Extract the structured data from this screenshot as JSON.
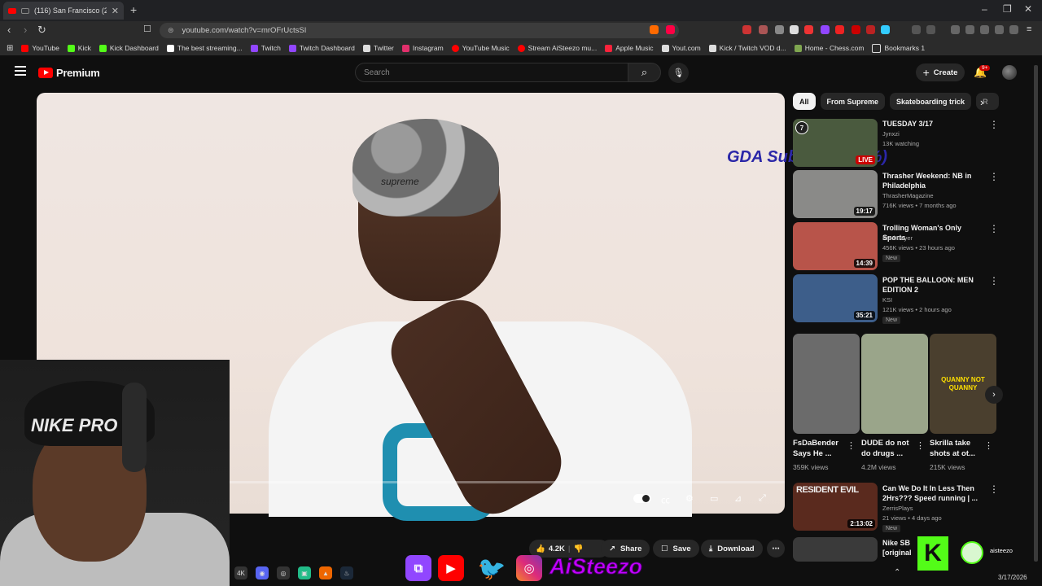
{
  "browser": {
    "tab_title": "(116) San Francisco (2026) - Y",
    "new_tab": "+",
    "url": "youtube.com/watch?v=mrOFrUctsSI",
    "window_controls": [
      "–",
      "❐",
      "✕"
    ]
  },
  "bookmarks": [
    {
      "label": "YouTube",
      "color": "#ff0000"
    },
    {
      "label": "Kick",
      "color": "#53fc18"
    },
    {
      "label": "Kick Dashboard",
      "color": "#53fc18"
    },
    {
      "label": "The best streaming...",
      "color": "#ffffff"
    },
    {
      "label": "Twitch",
      "color": "#9146ff"
    },
    {
      "label": "Twitch Dashboard",
      "color": "#9146ff"
    },
    {
      "label": "Twitter",
      "color": "#dddddd"
    },
    {
      "label": "Instagram",
      "color": "#e1306c"
    },
    {
      "label": "YouTube Music",
      "color": "#ff0000"
    },
    {
      "label": "Stream AiSteezo mu...",
      "color": "#ff0000"
    },
    {
      "label": "Apple Music",
      "color": "#fa233b"
    },
    {
      "label": "Yout.com",
      "color": "#dddddd"
    },
    {
      "label": "Kick / Twitch VOD d...",
      "color": "#dddddd"
    },
    {
      "label": "Home - Chess.com",
      "color": "#7fa650"
    },
    {
      "label": "Bookmarks 1",
      "color": "#dddddd"
    }
  ],
  "youtube": {
    "logo_text": "Premium",
    "search_placeholder": "Search",
    "create_label": "Create",
    "notif_badge": "9+"
  },
  "video": {
    "bandana_text": "supreme",
    "overlay_text": "GDA Subs: 5/67 (7%)",
    "actions": {
      "likes": "4.2K",
      "share": "Share",
      "save": "Save",
      "download": "Download"
    }
  },
  "webcam": {
    "hat_text": "NIKE PRO"
  },
  "stream_branding": {
    "name": "AiSteezo",
    "kick_user": "aisteezo"
  },
  "chips": [
    "All",
    "From Supreme",
    "Skateboarding trick",
    "R"
  ],
  "recommended": [
    {
      "title": "TUESDAY 3/17",
      "channel": "Jynxzi",
      "meta": "13K watching",
      "duration": "LIVE",
      "new": "",
      "thumb": "#4a5a3e"
    },
    {
      "title": "Thrasher Weekend: NB in Philadelphia",
      "channel": "ThrasherMagazine",
      "meta": "716K views • 7 months ago",
      "duration": "19:17",
      "new": "",
      "thumb": "#8a8a88"
    },
    {
      "title": "Trolling Woman's Only Sports",
      "channel": "Fred Beyer",
      "meta": "456K views • 23 hours ago",
      "duration": "14:39",
      "new": "New",
      "thumb": "#b8544a"
    },
    {
      "title": "POP THE BALLOON: MEN EDITION 2",
      "channel": "KSI",
      "meta": "121K views • 2 hours ago",
      "duration": "35:21",
      "new": "New",
      "thumb": "#3d5e8a"
    }
  ],
  "shorts": [
    {
      "title": "FsDaBender Says He ...",
      "views": "359K views",
      "thumb": "#6b6b6b"
    },
    {
      "title": "DUDE do not do drugs ...",
      "views": "4.2M views",
      "thumb": "#9aa58a"
    },
    {
      "title": "Skrilla take shots at ot...",
      "views": "215K views",
      "thumb": "#4a3f2e",
      "caption": "QUANNY NOT QUANNY"
    }
  ],
  "recommended2": [
    {
      "title": "Can We Do It In Less Then 2Hrs??? Speed running | ...",
      "channel": "ZerrisPlays",
      "meta": "21 views • 4 days ago",
      "duration": "2:13:02",
      "new": "New",
      "thumb": "#5a2a1e",
      "thumb_text": "RESIDENT EVIL"
    },
    {
      "title": "Nike SB [original",
      "thumb": "#3a3a3a"
    }
  ],
  "taskbar": {
    "date": "3/17/2026"
  }
}
